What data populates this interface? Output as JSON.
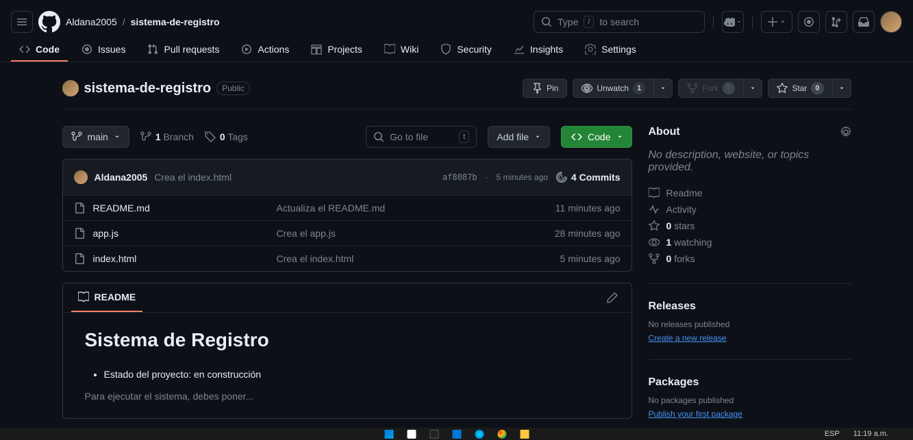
{
  "header": {
    "owner": "Aldana2005",
    "repo": "sistema-de-registro",
    "search_prefix": "Type",
    "search_kbd": "/",
    "search_suffix": "to search"
  },
  "nav": {
    "code": "Code",
    "issues": "Issues",
    "pulls": "Pull requests",
    "actions": "Actions",
    "projects": "Projects",
    "wiki": "Wiki",
    "security": "Security",
    "insights": "Insights",
    "settings": "Settings"
  },
  "repo": {
    "name": "sistema-de-registro",
    "visibility": "Public",
    "pin": "Pin",
    "unwatch": "Unwatch",
    "watch_count": "1",
    "fork": "Fork",
    "fork_count": "0",
    "star": "Star",
    "star_count": "0"
  },
  "toolbar": {
    "branch": "main",
    "branches_count": "1",
    "branches_label": "Branch",
    "tags_count": "0",
    "tags_label": "Tags",
    "gotofile": "Go to file",
    "gotofile_kbd": "t",
    "addfile": "Add file",
    "code_btn": "Code"
  },
  "commit": {
    "author": "Aldana2005",
    "message": "Crea el index.html",
    "hash": "af8087b",
    "sep": "·",
    "time": "5 minutes ago",
    "commits_count": "4 Commits"
  },
  "files": [
    {
      "name": "README.md",
      "msg": "Actualiza el README.md",
      "time": "11 minutes ago"
    },
    {
      "name": "app.js",
      "msg": "Crea el app.js",
      "time": "28 minutes ago"
    },
    {
      "name": "index.html",
      "msg": "Crea el index.html",
      "time": "5 minutes ago"
    }
  ],
  "readme": {
    "tab": "README",
    "title": "Sistema de Registro",
    "bullet": "Estado del proyecto: en construcción",
    "paragraph": "Para ejecutar el sistema, debes poner..."
  },
  "about": {
    "title": "About",
    "desc": "No description, website, or topics provided.",
    "readme": "Readme",
    "activity": "Activity",
    "stars_count": "0",
    "stars_label": "stars",
    "watching_count": "1",
    "watching_label": "watching",
    "forks_count": "0",
    "forks_label": "forks"
  },
  "releases": {
    "title": "Releases",
    "none": "No releases published",
    "link": "Create a new release"
  },
  "packages": {
    "title": "Packages",
    "none": "No packages published",
    "link": "Publish your first package"
  },
  "taskbar": {
    "lang": "ESP",
    "time": "11:19 a.m."
  }
}
